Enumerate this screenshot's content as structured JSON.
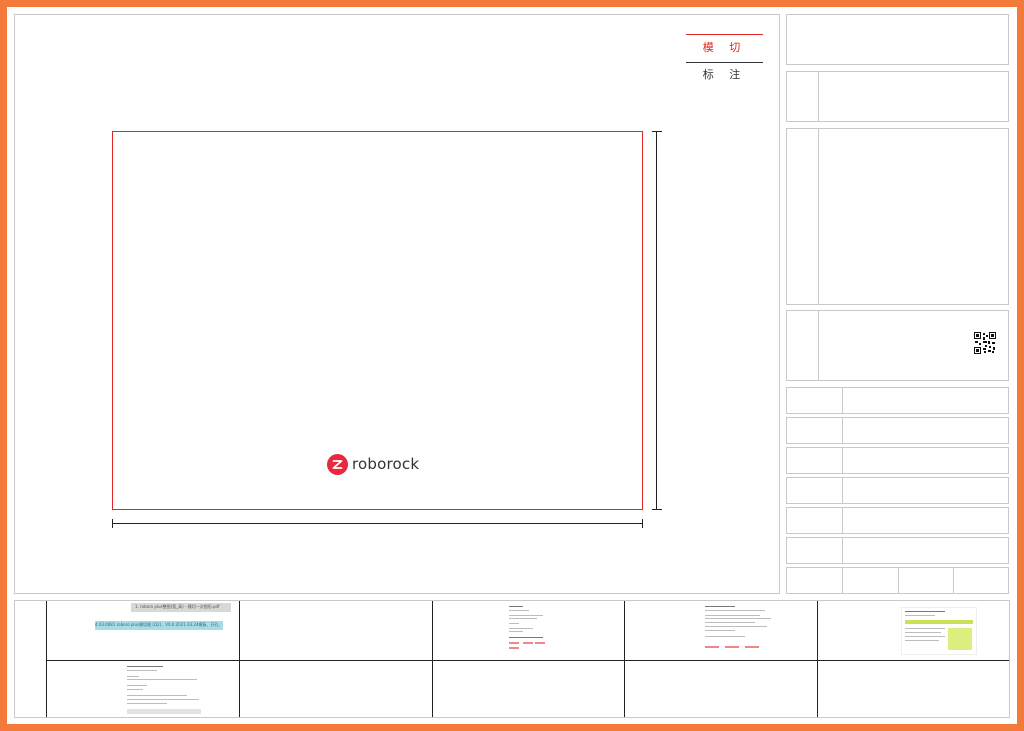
{
  "legend": {
    "cut_label": "模 切",
    "mark_label": "标 注"
  },
  "logo": {
    "text": "roborock"
  },
  "thumbnails": {
    "t1_top": "1. roboro plus整图(宽_高) - 模切一次图形.pdf",
    "t1_highlight": "4.03.0081 roboro plus模切图 (Q2)、V0.0.2021.03.24模板、开孔、模切文件"
  },
  "colors": {
    "frame": "#f47a3c",
    "cut_line": "#e32524",
    "logo_mark": "#e8283c"
  }
}
